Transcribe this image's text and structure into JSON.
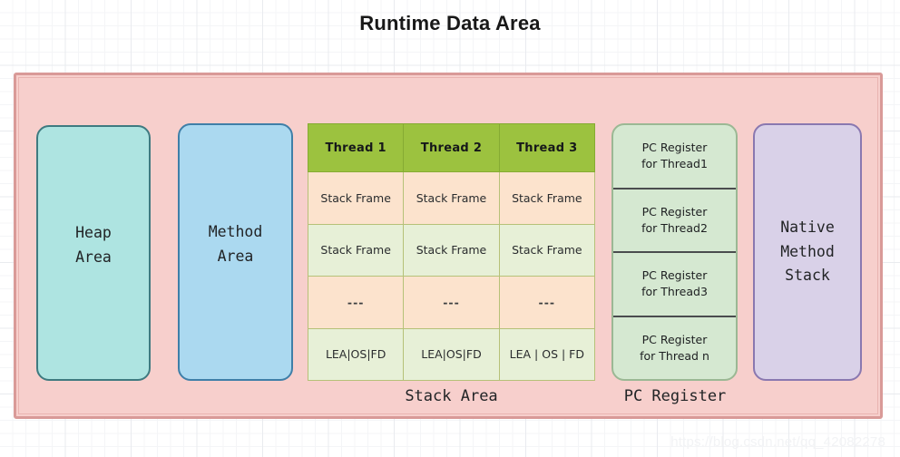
{
  "diagram": {
    "title": "Runtime Data Area",
    "watermark": "https://blog.csdn.net/qq_42082278",
    "colors": {
      "outer_area_fill": "#f7cfcc",
      "outer_area_border": "#d99a98",
      "heap_fill": "#aee4e1",
      "heap_border": "#3f7a80",
      "method_fill": "#abd9f0",
      "method_border": "#3f7fa8",
      "native_fill": "#d9d1e8",
      "native_border": "#8a78b0",
      "table_header_fill": "#9cc23f",
      "table_row_peach": "#fce3cd",
      "table_row_green": "#e7f0d7",
      "table_border": "#b6c178",
      "pc_register_fill": "#d5e8d1",
      "pc_register_border": "#9bb894",
      "grid_minor": "#f4f5f7",
      "grid_major": "#e9ebef"
    }
  },
  "regions": {
    "heap": {
      "label": "Heap\nArea"
    },
    "method": {
      "label": "Method\nArea"
    },
    "native_method_stack": {
      "label": "Native\nMethod\nStack"
    }
  },
  "stack_area": {
    "caption": "Stack Area",
    "columns": [
      "Thread 1",
      "Thread 2",
      "Thread 3"
    ],
    "rows": [
      {
        "style": "peach",
        "cells": [
          "Stack Frame",
          "Stack Frame",
          "Stack Frame"
        ]
      },
      {
        "style": "green",
        "cells": [
          "Stack Frame",
          "Stack Frame",
          "Stack Frame"
        ]
      },
      {
        "style": "peach",
        "cells": [
          "---",
          "---",
          "---"
        ]
      },
      {
        "style": "green",
        "cells": [
          "LEA|OS|FD",
          "LEA|OS|FD",
          "LEA | OS | FD"
        ]
      }
    ]
  },
  "pc_register": {
    "caption": "PC Register",
    "cells": [
      "PC Register\nfor  Thread1",
      "PC Register\nfor  Thread2",
      "PC Register\nfor  Thread3",
      "PC Register\nfor  Thread n"
    ]
  }
}
